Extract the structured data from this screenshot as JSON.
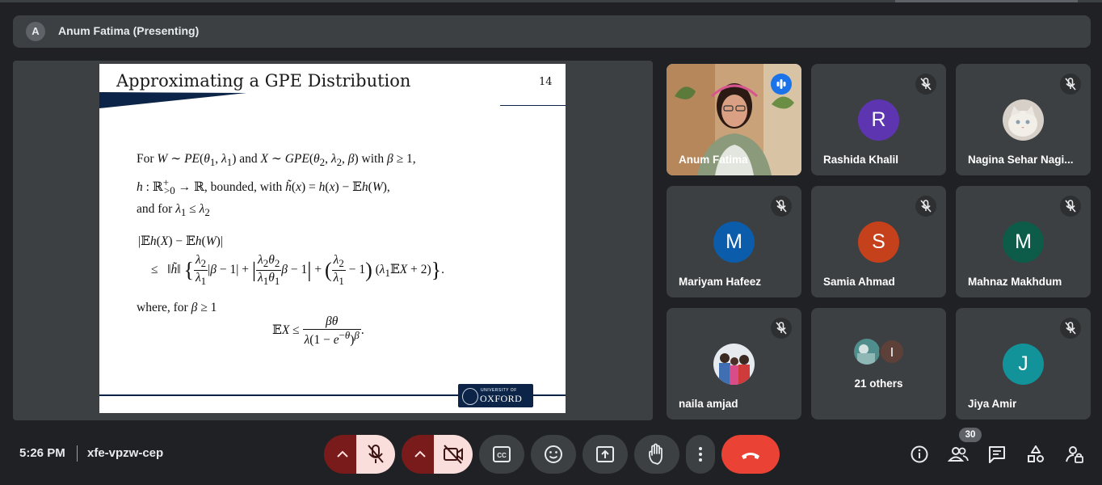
{
  "presenter": {
    "avatar_letter": "A",
    "title": "Anum Fatima (Presenting)"
  },
  "slide": {
    "title": "Approximating a GPE Distribution",
    "page_number": "14",
    "logo_small": "UNIVERSITY OF",
    "logo_big": "OXFORD"
  },
  "participants": [
    {
      "name": "Anum Fatima",
      "type": "video",
      "speaking": true
    },
    {
      "name": "Rashida Khalil",
      "type": "letter",
      "letter": "R",
      "color": "#5e35b1",
      "muted": true
    },
    {
      "name": "Nagina Sehar Nagi...",
      "type": "photo",
      "muted": true
    },
    {
      "name": "Mariyam Hafeez",
      "type": "letter",
      "letter": "M",
      "color": "#0b5cab",
      "muted": true
    },
    {
      "name": "Samia Ahmad",
      "type": "letter",
      "letter": "S",
      "color": "#c5411b",
      "muted": true
    },
    {
      "name": "Mahnaz Makhdum",
      "type": "letter",
      "letter": "M",
      "color": "#0d5c4a",
      "muted": true
    },
    {
      "name": "naila amjad",
      "type": "photo",
      "muted": true
    },
    {
      "name": "21 others",
      "type": "group",
      "letter": "I",
      "color": "#5d4037"
    },
    {
      "name": "Jiya Amir",
      "type": "letter",
      "letter": "J",
      "color": "#12939a",
      "muted": true
    }
  ],
  "meeting": {
    "time": "5:26 PM",
    "code": "xfe-vpzw-cep"
  },
  "toolbar": {
    "people_count": "30"
  },
  "icons": {
    "mic_options": "chevron-up-icon",
    "mic": "mic-off-icon",
    "cam_options": "chevron-up-icon",
    "camera": "camera-off-icon",
    "captions": "captions-icon",
    "reactions": "emoji-icon",
    "present": "present-screen-icon",
    "raise_hand": "hand-icon",
    "more": "more-vert-icon",
    "leave": "call-end-icon",
    "info": "info-icon",
    "people": "people-icon",
    "chat": "chat-icon",
    "activities": "activities-icon",
    "host_controls": "lock-person-icon"
  },
  "colors": {
    "background": "#202124",
    "tile": "#3c4043",
    "leave": "#ea4335",
    "muted_pill": "#f9dedc",
    "speaking_border": "#8ab4f8"
  }
}
